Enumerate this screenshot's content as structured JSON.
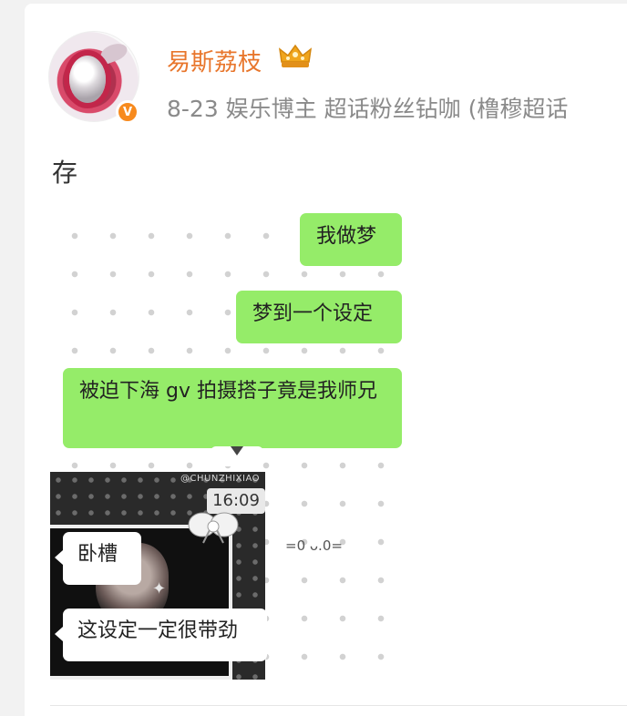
{
  "post": {
    "username": "易斯荔枝",
    "meta": "8-23  娱乐博主 超话粉丝钻咖 (橹穆超话",
    "text": "存"
  },
  "chat": {
    "bubbles_right": [
      "我做梦",
      "梦到一个设定",
      "被迫下海 gv 拍摄搭子竟是我师兄"
    ],
    "time": "16:09",
    "watermark": "@CHUNZHIXIAO",
    "bubbles_left": [
      "卧槽",
      "这设定一定很带劲"
    ],
    "emoticon": "=0 ᴗ.0="
  },
  "colors": {
    "accent": "#e8762c",
    "verified": "#f78a1e",
    "bubble_green": "#95ec69"
  },
  "icons": {
    "badge": "crown-icon",
    "verified": "verified-v-icon"
  }
}
